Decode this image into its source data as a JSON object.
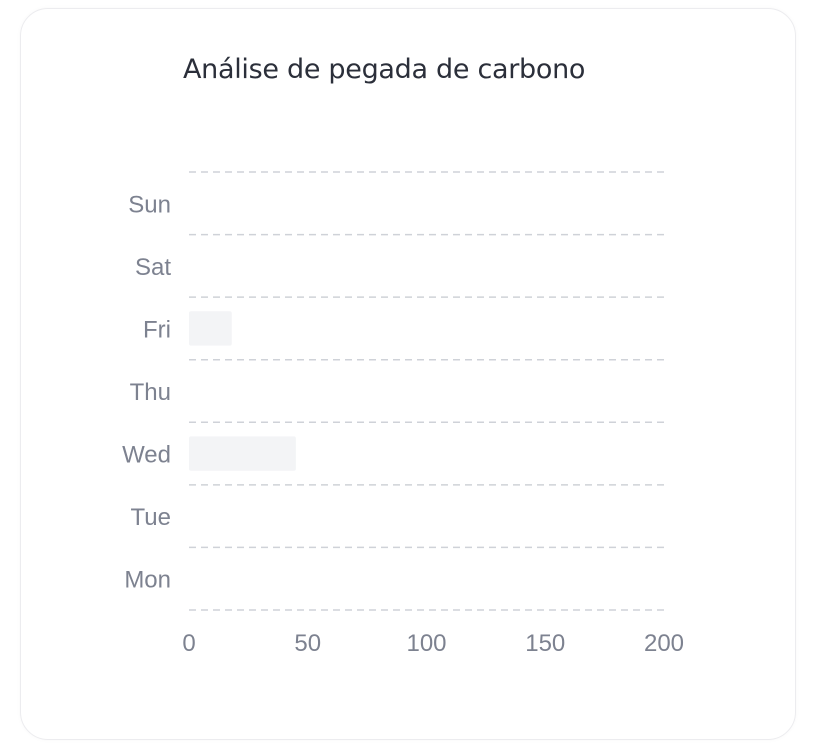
{
  "chart_data": {
    "type": "bar",
    "orientation": "horizontal",
    "title": "Análise de pegada de carbono",
    "categories": [
      "Mon",
      "Tue",
      "Wed",
      "Thu",
      "Fri",
      "Sat",
      "Sun"
    ],
    "series": [
      {
        "values": [
          0,
          0,
          45,
          0,
          18,
          0,
          0
        ]
      }
    ],
    "xlabel": "",
    "ylabel": "",
    "xlim": [
      0,
      200
    ],
    "x_ticks": [
      "0",
      "50",
      "100",
      "150",
      "200"
    ],
    "grid": "horizontal dashed",
    "bar_color": "#f3f4f6",
    "grid_color": "#cfd2d8",
    "tick_color": "#7d8290"
  }
}
